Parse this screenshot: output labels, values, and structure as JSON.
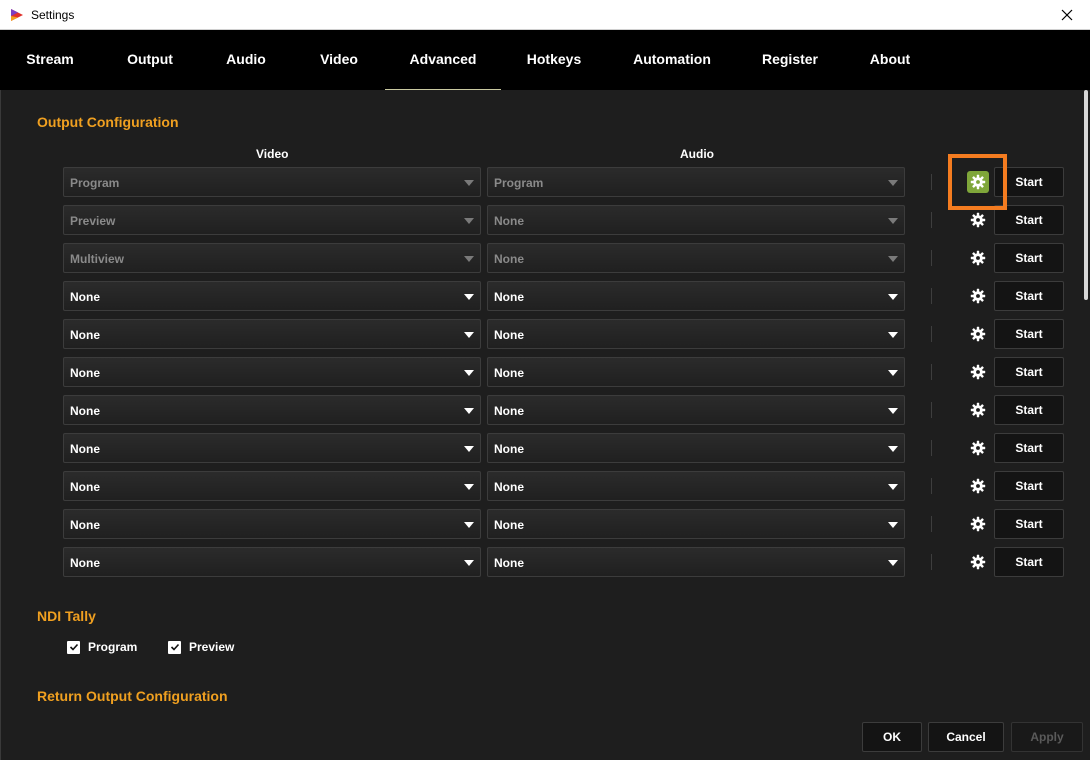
{
  "window": {
    "title": "Settings"
  },
  "tabs": [
    {
      "label": "Stream"
    },
    {
      "label": "Output"
    },
    {
      "label": "Audio"
    },
    {
      "label": "Video"
    },
    {
      "label": "Advanced",
      "active": true
    },
    {
      "label": "Hotkeys"
    },
    {
      "label": "Automation"
    },
    {
      "label": "Register"
    },
    {
      "label": "About"
    }
  ],
  "output_config": {
    "title": "Output Configuration",
    "video_header": "Video",
    "audio_header": "Audio",
    "start_label": "Start",
    "rows": [
      {
        "video": "Program",
        "audio": "Program",
        "disabled": true
      },
      {
        "video": "Preview",
        "audio": "None",
        "disabled": true
      },
      {
        "video": "Multiview",
        "audio": "None",
        "disabled": true
      },
      {
        "video": "None",
        "audio": "None",
        "disabled": false
      },
      {
        "video": "None",
        "audio": "None",
        "disabled": false
      },
      {
        "video": "None",
        "audio": "None",
        "disabled": false
      },
      {
        "video": "None",
        "audio": "None",
        "disabled": false
      },
      {
        "video": "None",
        "audio": "None",
        "disabled": false
      },
      {
        "video": "None",
        "audio": "None",
        "disabled": false
      },
      {
        "video": "None",
        "audio": "None",
        "disabled": false
      },
      {
        "video": "None",
        "audio": "None",
        "disabled": false
      }
    ]
  },
  "ndi_tally": {
    "title": "NDI Tally",
    "options": [
      {
        "label": "Program",
        "checked": true
      },
      {
        "label": "Preview",
        "checked": true
      }
    ]
  },
  "return_output": {
    "title": "Return Output Configuration"
  },
  "footer": {
    "ok_label": "OK",
    "cancel_label": "Cancel",
    "apply_label": "Apply"
  },
  "colors": {
    "accent": "#f0a020",
    "highlight": "#f47c20",
    "gear_active": "#7fa63a"
  },
  "icons": {
    "close": "close-icon",
    "settings": "gear-icon",
    "check": "checkmark-icon",
    "app": "app-logo-icon"
  }
}
